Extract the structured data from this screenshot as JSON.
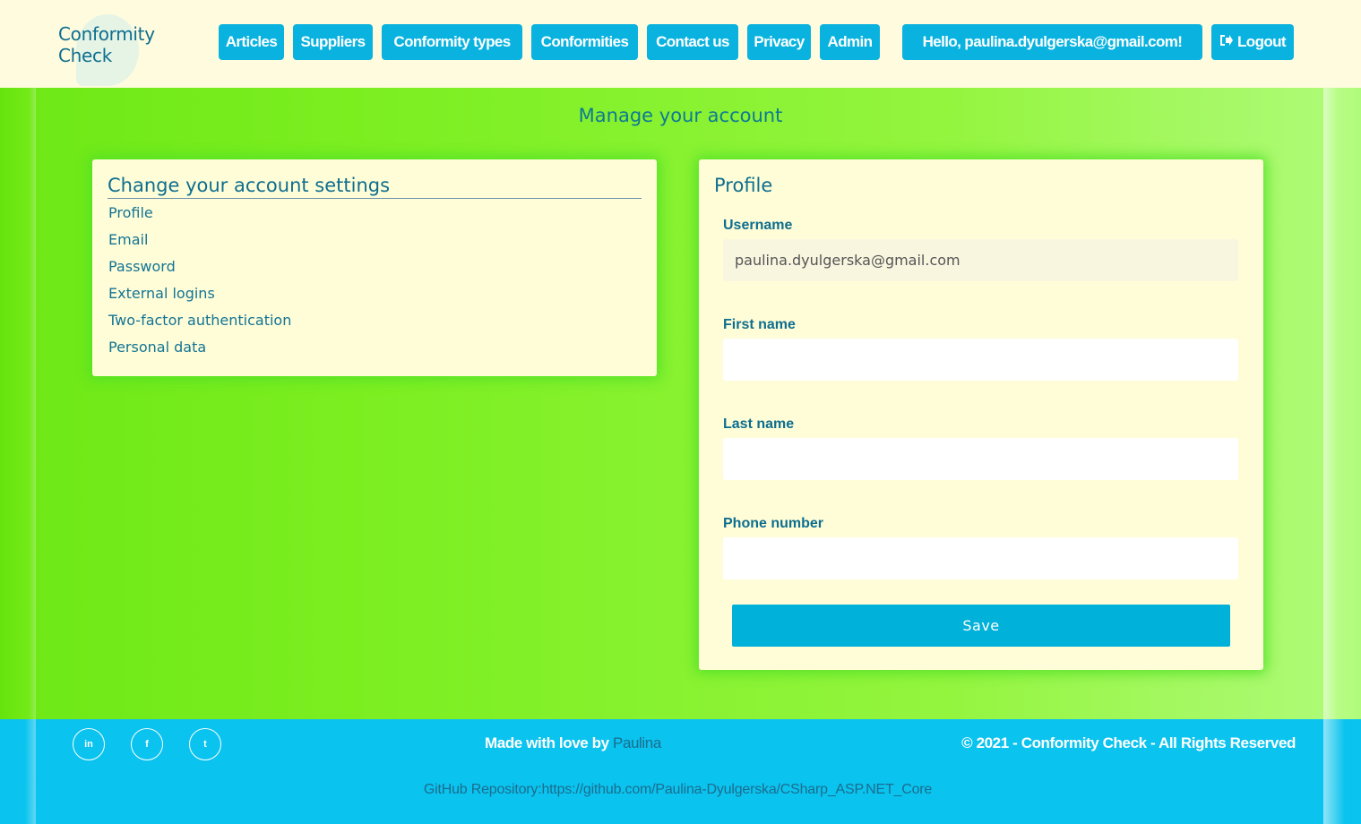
{
  "brand": {
    "line1": "Conformity",
    "line2": "Check"
  },
  "nav": {
    "items": [
      {
        "label": "Articles"
      },
      {
        "label": "Suppliers"
      },
      {
        "label": "Conformity types"
      },
      {
        "label": "Conformities"
      },
      {
        "label": "Contact us"
      },
      {
        "label": "Privacy"
      },
      {
        "label": "Admin"
      }
    ],
    "greeting": "Hello, paulina.dyulgerska@gmail.com!",
    "logout": "Logout",
    "logout_icon": "sign-out-icon"
  },
  "page": {
    "title": "Manage your account"
  },
  "settings": {
    "heading": "Change your account settings",
    "links": [
      {
        "label": "Profile"
      },
      {
        "label": "Email"
      },
      {
        "label": "Password"
      },
      {
        "label": "External logins"
      },
      {
        "label": "Two-factor authentication"
      },
      {
        "label": "Personal data"
      }
    ]
  },
  "profile": {
    "heading": "Profile",
    "username_label": "Username",
    "username_value": "paulina.dyulgerska@gmail.com",
    "first_name_label": "First name",
    "first_name_value": "",
    "last_name_label": "Last name",
    "last_name_value": "",
    "phone_label": "Phone number",
    "phone_value": "",
    "save_label": "Save"
  },
  "footer": {
    "social": [
      {
        "icon": "linkedin-icon",
        "glyph": "in"
      },
      {
        "icon": "facebook-icon",
        "glyph": "f"
      },
      {
        "icon": "twitter-icon",
        "glyph": "t"
      }
    ],
    "made_with": "Made with love by",
    "author": "Paulina",
    "copyright": "© 2021 - Conformity Check - All Rights Reserved",
    "github": "GitHub Repository:https://github.com/Paulina-Dyulgerska/CSharp_ASP.NET_Core"
  },
  "colors": {
    "accent": "#0ab3df",
    "header_bg": "#fffbde",
    "card_bg": "#fffdd7",
    "text": "#0e6e8f",
    "footer_bg": "#0ac3ee"
  }
}
